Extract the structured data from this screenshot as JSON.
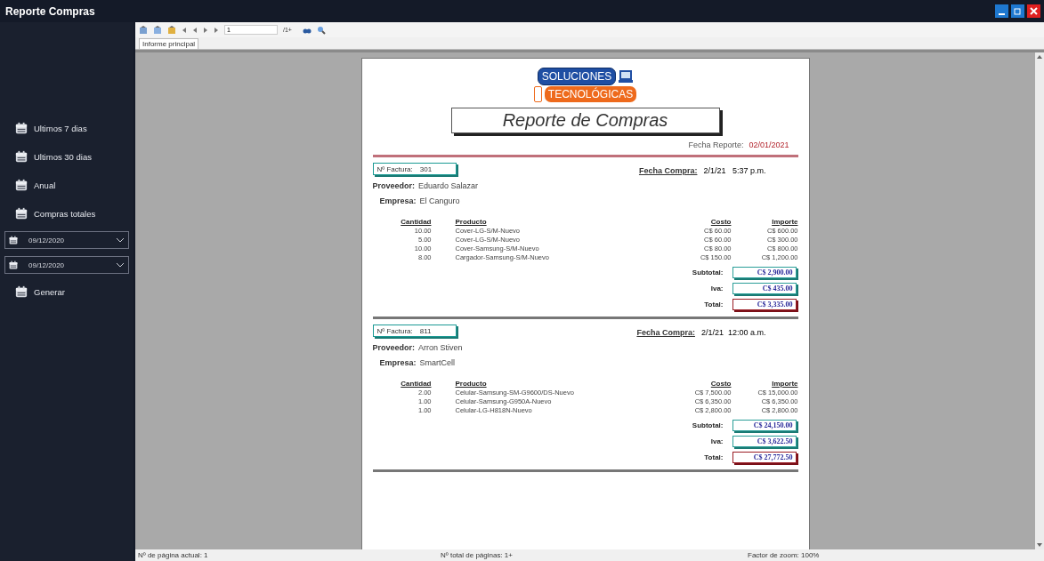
{
  "window": {
    "title": "Reporte Compras"
  },
  "sidebar": {
    "items": [
      {
        "kind": "button",
        "label": "Ultimos 7 dias"
      },
      {
        "kind": "button",
        "label": "Ultimos 30 dias"
      },
      {
        "kind": "button",
        "label": "Anual"
      },
      {
        "kind": "button",
        "label": "Compras totales"
      },
      {
        "kind": "date",
        "value": "09/12/2020"
      },
      {
        "kind": "date",
        "value": "09/12/2020"
      },
      {
        "kind": "button",
        "label": "Generar"
      }
    ]
  },
  "viewer": {
    "toolbar": {
      "page_field": "1",
      "page_total": "/1+"
    },
    "tabs": [
      {
        "label": "Informe principal",
        "selected": true
      }
    ],
    "report": {
      "logo": {
        "line_1": "SOLUCIONES",
        "line_2": "TECNOLÓGICAS"
      },
      "title": "Reporte de Compras",
      "report_date_label": "Fecha Reporte:",
      "report_date": "02/01/2021",
      "invoices": [
        {
          "invoice_label": "Nº Factura:",
          "number": "301",
          "purchase_date_label": "Fecha Compra:",
          "purchase_date": "2/1/21   5:37 p.m.",
          "supplier_label": "Proveedor:",
          "supplier": "Eduardo Salazar",
          "company_label": "Empresa:",
          "company": "El Canguro",
          "columns": [
            "Cantidad",
            "Producto",
            "Costo",
            "Importe"
          ],
          "rows": [
            [
              "10.00",
              "Cover-LG-S/M-Nuevo",
              "C$ 60.00",
              "C$ 600.00"
            ],
            [
              "5.00",
              "Cover-LG-S/M-Nuevo",
              "C$ 60.00",
              "C$ 300.00"
            ],
            [
              "10.00",
              "Cover-Samsung-S/M-Nuevo",
              "C$ 80.00",
              "C$ 800.00"
            ],
            [
              "8.00",
              "Cargador-Samsung-S/M-Nuevo",
              "C$ 150.00",
              "C$ 1,200.00"
            ]
          ],
          "totals": [
            {
              "kind": "subtotal",
              "label": "Subtotal:",
              "value": "C$ 2,900.00"
            },
            {
              "kind": "iva",
              "label": "Iva:",
              "value": "C$ 435.00"
            },
            {
              "kind": "total",
              "label": "Total:",
              "value": "C$ 3,335.00"
            }
          ]
        },
        {
          "invoice_label": "Nº Factura:",
          "number": "811",
          "purchase_date_label": "Fecha Compra:",
          "purchase_date": "2/1/21  12:00 a.m.",
          "supplier_label": "Proveedor:",
          "supplier": "Arron Stiven",
          "company_label": "Empresa:",
          "company": "SmartCell",
          "columns": [
            "Cantidad",
            "Producto",
            "Costo",
            "Importe"
          ],
          "rows": [
            [
              "2.00",
              "Celular-Samsung-SM-G9600/DS-Nuevo",
              "C$ 7,500.00",
              "C$ 15,000.00"
            ],
            [
              "1.00",
              "Celular-Samsung-G950A-Nuevo",
              "C$ 6,350.00",
              "C$ 6,350.00"
            ],
            [
              "1.00",
              "Celular-LG-H818N-Nuevo",
              "C$ 2,800.00",
              "C$ 2,800.00"
            ]
          ],
          "totals": [
            {
              "kind": "subtotal",
              "label": "Subtotal:",
              "value": "C$ 24,150.00"
            },
            {
              "kind": "iva",
              "label": "Iva:",
              "value": "C$ 3,622.50"
            },
            {
              "kind": "total",
              "label": "Total:",
              "value": "C$ 27,772.50"
            }
          ]
        }
      ]
    }
  },
  "status_bar": [
    "Nº de página actual: 1",
    "Nº total de páginas: 1+",
    "Factor de zoom: 100%"
  ]
}
